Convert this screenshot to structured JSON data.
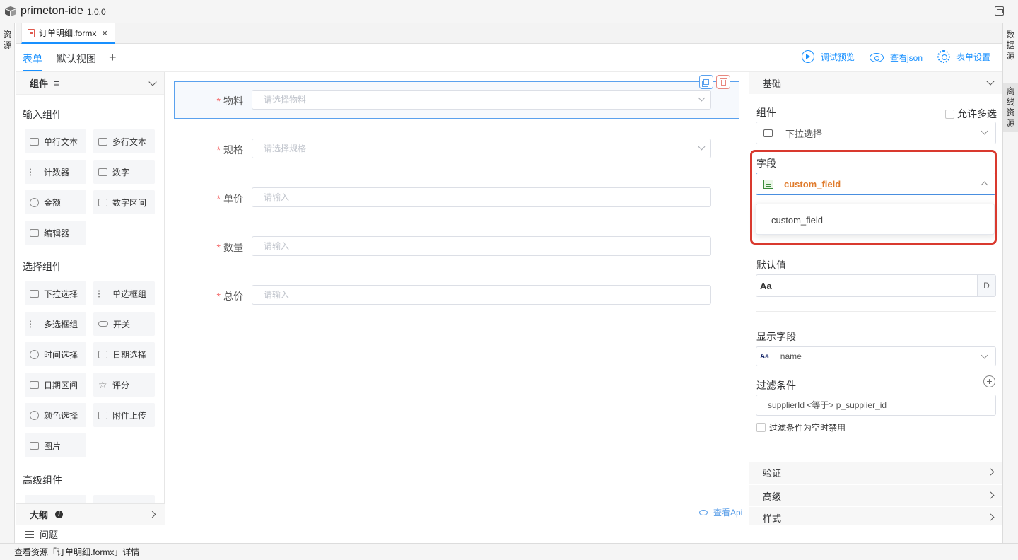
{
  "app": {
    "name": "primeton-ide",
    "version": "1.0.0"
  },
  "left_rail": {
    "tab": "资\n源"
  },
  "right_rail": {
    "tabs": [
      "数\n据\n源",
      "离\n线\n资\n源"
    ]
  },
  "editor_tab": {
    "label": "订单明细.formx",
    "close": "×"
  },
  "designer": {
    "tabs": [
      "表单",
      "默认视图"
    ],
    "add": "+",
    "actions": [
      "调试预览",
      "查看json",
      "表单设置"
    ]
  },
  "components_panel": {
    "title": "组件",
    "menu_glyph": "≡",
    "sections": {
      "input": "输入组件",
      "select": "选择组件",
      "advanced": "高级组件"
    },
    "input_items": [
      "单行文本",
      "多行文本",
      "计数器",
      "数字",
      "金额",
      "数字区间",
      "编辑器"
    ],
    "select_items": [
      "下拉选择",
      "单选框组",
      "多选框组",
      "开关",
      "时间选择",
      "日期选择",
      "日期区间",
      "评分",
      "颜色选择",
      "附件上传",
      "图片"
    ],
    "outline": "大纲",
    "outline_info": "i"
  },
  "form": {
    "fields": [
      {
        "label": "物料",
        "placeholder": "请选择物料"
      },
      {
        "label": "规格",
        "placeholder": "请选择规格"
      },
      {
        "label": "单价",
        "placeholder": "请输入"
      },
      {
        "label": "数量",
        "placeholder": "请输入"
      },
      {
        "label": "总价",
        "placeholder": "请输入"
      }
    ],
    "required_mark": "*",
    "view_api": "查看Api"
  },
  "properties": {
    "basic": "基础",
    "component_label": "组件",
    "multi_select_label": "允许多选",
    "component_value": "下拉选择",
    "field_label": "字段",
    "field_value": "custom_field",
    "field_option": "custom_field",
    "default_label": "默认值",
    "default_aa": "Aa",
    "default_btn": "D",
    "display_label": "显示字段",
    "display_aa": "Aa",
    "display_value": "name",
    "filter_label": "过滤条件",
    "filter_add": "+",
    "filter_value": "supplierId <等于> p_supplier_id",
    "filter_disable_label": "过滤条件为空时禁用",
    "sections": [
      "验证",
      "高级",
      "样式"
    ],
    "highlight_color": "#d9392e"
  },
  "problems": "问题",
  "status": "查看资源「订单明细.formx」详情"
}
